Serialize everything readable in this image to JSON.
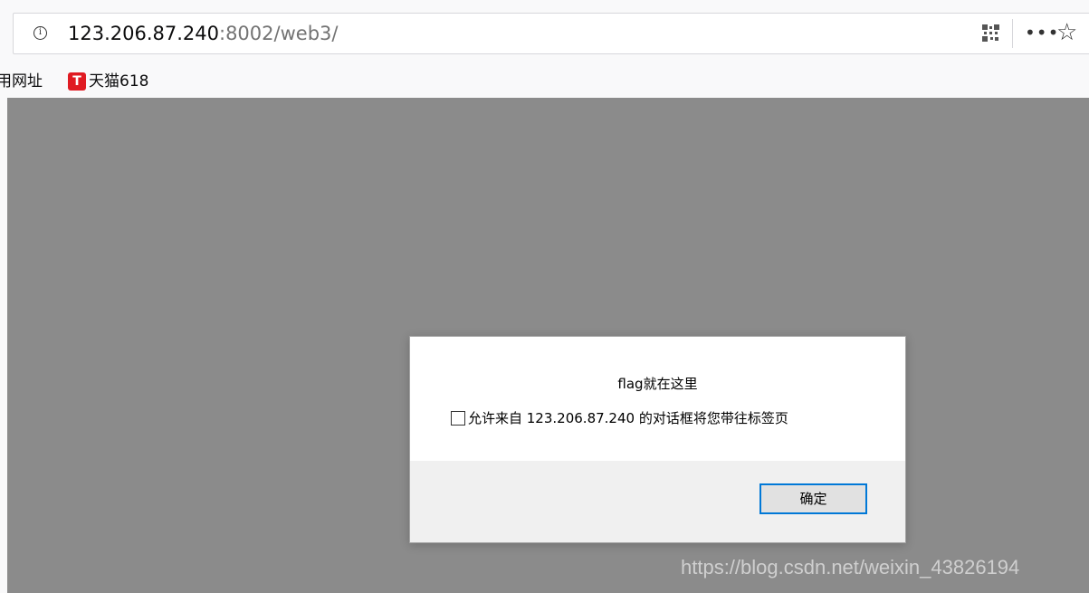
{
  "browser": {
    "url_host": "123.206.87.240",
    "url_rest": ":8002/web3/",
    "icons": {
      "info": "info-circle-icon",
      "qr": "qr-code-icon",
      "more": "more-dots-icon",
      "star": "bookmark-star-icon"
    },
    "info_glyph": "i",
    "more_glyph": "•••",
    "star_glyph": "☆"
  },
  "bookmarks": {
    "items": [
      {
        "label": "用网址"
      },
      {
        "label": "天猫618",
        "icon": "tmall-icon",
        "icon_glyph": "T",
        "icon_color": "#e01b22"
      }
    ]
  },
  "page": {
    "background_color": "#8b8b8b"
  },
  "dialog": {
    "message": "flag就在这里",
    "checkbox_label": "允许来自 123.206.87.240 的对话框将您带往标签页",
    "checkbox_checked": false,
    "ok_label": "确定",
    "accent_color": "#0078d7"
  },
  "watermark": {
    "text": "https://blog.csdn.net/weixin_43826194"
  }
}
